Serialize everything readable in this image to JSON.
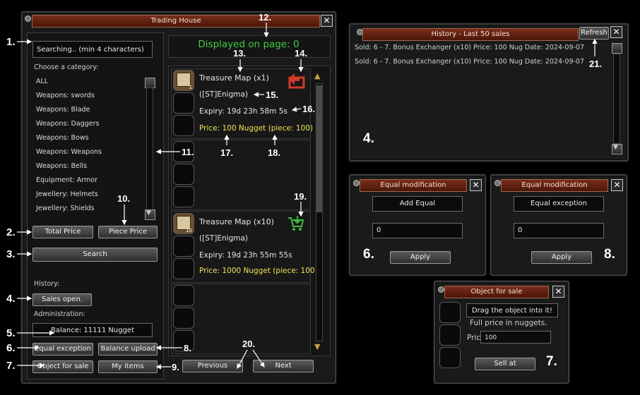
{
  "trading": {
    "title": "Trading House",
    "search_value": "Searching.. (min 4 characters)",
    "choose_category": "Choose a category:",
    "categories": [
      "ALL",
      "Weapons: swords",
      "Weapons: Blade",
      "Weapons: Daggers",
      "Weapons: Bows",
      "Weapons: Weapons",
      "Weapons: Bells",
      "Equipment: Armor",
      "Jewellery: Helmets",
      "Jewellery: Shields"
    ],
    "total_price": "Total Price",
    "piece_price": "Piece Price",
    "search": "Search",
    "history_label": "History:",
    "sales_open": "Sales open.",
    "admin_label": "Administration:",
    "balance": "Balance: 11111 Nugget",
    "equal_exception": "Equal exception",
    "balance_upload": "Balance upload",
    "object_for_sale": "Object for sale",
    "my_items": "My items",
    "displayed": "Displayed on page: 0",
    "previous": "Previous",
    "next": "Next",
    "items": [
      {
        "name": "Treasure Map (x1)",
        "seller": "([ST]Enigma)",
        "expiry": "Expiry: 19d  23h  58m 5s",
        "price": "Price: 100 Nugget (piece: 100)",
        "qty": "1"
      },
      {
        "name": "Treasure Map (x10)",
        "seller": "([ST]Enigma)",
        "expiry": "Expiry: 19d  23h  55m 55s",
        "price": "Price: 1000 Nugget (piece: 100)",
        "qty": "10"
      }
    ]
  },
  "history": {
    "title": "History - Last 50 sales",
    "refresh": "Refresh",
    "rows": [
      "Sold: 6 - 7. Bonus Exchanger (x10) Price: 100 Nug Date: 2024-09-07",
      "Sold: 6 - 7. Bonus Exchanger (x10) Price: 100 Nug Date: 2024-09-07"
    ]
  },
  "equal1": {
    "title": "Equal modification",
    "field_label": "Add Equal",
    "value": "0",
    "apply": "Apply"
  },
  "equal2": {
    "title": "Equal modification",
    "field_label": "Equal exception",
    "value": "0",
    "apply": "Apply"
  },
  "sale": {
    "title": "Object for sale",
    "drag": "Drag the object into it!",
    "full_price": "Full price in nuggets.",
    "price_label": "Price",
    "value": "100",
    "sell": "Sell at"
  },
  "annotations": {
    "n1": "1.",
    "n2": "2.",
    "n3": "3.",
    "n4": "4.",
    "n5": "5.",
    "n6": "6.",
    "n7": "7.",
    "n8": "8.",
    "n9": "9.",
    "n10": "10.",
    "n11": "11.",
    "n12": "12.",
    "n13": "13.",
    "n14": "14.",
    "n15": "15.",
    "n16": "16.",
    "n17": "17.",
    "n18": "18.",
    "n19": "19.",
    "n20": "20.",
    "n21": "21.",
    "h4": "4.",
    "e6": "6.",
    "e8": "8.",
    "s7": "7."
  },
  "colors": {
    "accent_title": "#6a2412",
    "displayed_green": "#3ecf3e",
    "price_yellow": "#f0e45a",
    "refund_red": "#d23a2a",
    "cart_green": "#3dbb3d"
  }
}
